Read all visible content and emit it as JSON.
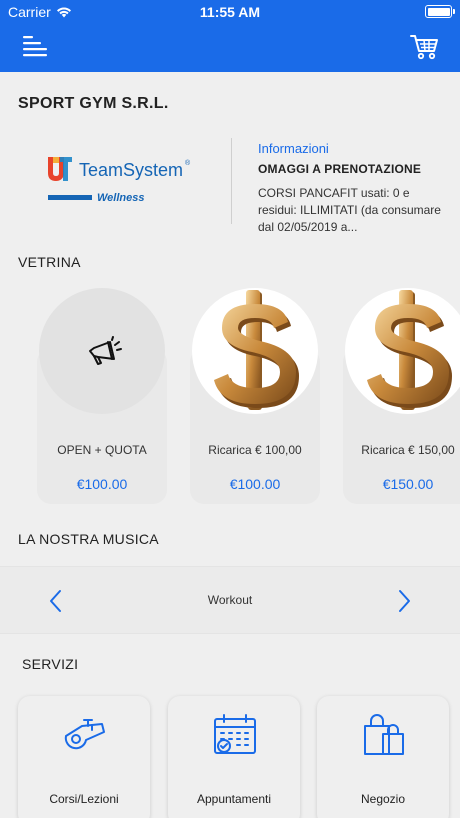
{
  "status_bar": {
    "carrier": "Carrier",
    "time": "11:55 AM"
  },
  "header": {
    "menu_icon": "menu-icon",
    "cart_icon": "cart-icon",
    "color": "#1a6be8"
  },
  "company_name": "SPORT GYM S.R.L.",
  "brand": {
    "name": "TeamSystem",
    "registered": "®",
    "sub": "Wellness"
  },
  "info": {
    "label": "Informazioni",
    "title": "OMAGGI A PRENOTAZIONE",
    "text": "CORSI PANCAFIT usati: 0 e residui: ILLIMITATI (da consumare dal 02/05/2019 a..."
  },
  "vetrina": {
    "title": "VETRINA",
    "products": [
      {
        "name": "OPEN + QUOTA",
        "price": "€100.00",
        "icon": "megaphone-icon"
      },
      {
        "name": "Ricarica € 100,00",
        "price": "€100.00",
        "icon": "dollar-icon"
      },
      {
        "name": "Ricarica € 150,00",
        "price": "€150.00",
        "icon": "dollar-icon"
      }
    ]
  },
  "music": {
    "title": "LA NOSTRA MUSICA",
    "track": "Workout",
    "prev_icon": "chevron-left-icon",
    "next_icon": "chevron-right-icon"
  },
  "servizi": {
    "title": "SERVIZI",
    "items": [
      {
        "label": "Corsi/Lezioni",
        "icon": "whistle-icon"
      },
      {
        "label": "Appuntamenti",
        "icon": "calendar-icon"
      },
      {
        "label": "Negozio",
        "icon": "shopping-bag-icon"
      }
    ]
  }
}
